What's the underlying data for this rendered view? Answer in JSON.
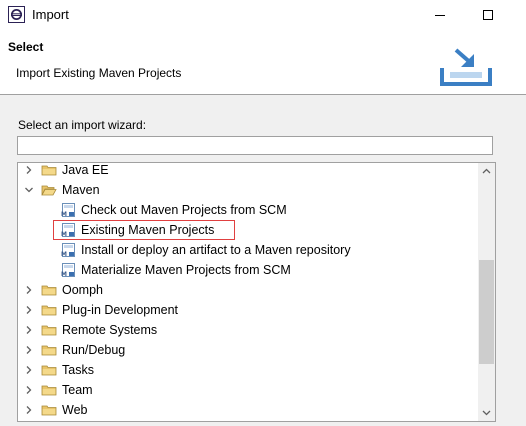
{
  "window": {
    "title": "Import"
  },
  "header": {
    "title": "Select",
    "description": "Import Existing Maven Projects"
  },
  "content": {
    "prompt": "Select an import wizard:",
    "filter_value": ""
  },
  "tree": {
    "items": [
      {
        "label": "Java EE",
        "level": 0,
        "expanded": false,
        "type": "folder"
      },
      {
        "label": "Maven",
        "level": 0,
        "expanded": true,
        "type": "folder"
      },
      {
        "label": "Check out Maven Projects from SCM",
        "level": 1,
        "type": "maven-wizard"
      },
      {
        "label": "Existing Maven Projects",
        "level": 1,
        "type": "maven-wizard",
        "selected": true
      },
      {
        "label": "Install or deploy an artifact to a Maven repository",
        "level": 1,
        "type": "maven-wizard"
      },
      {
        "label": "Materialize Maven Projects from SCM",
        "level": 1,
        "type": "maven-wizard"
      },
      {
        "label": "Oomph",
        "level": 0,
        "expanded": false,
        "type": "folder"
      },
      {
        "label": "Plug-in Development",
        "level": 0,
        "expanded": false,
        "type": "folder"
      },
      {
        "label": "Remote Systems",
        "level": 0,
        "expanded": false,
        "type": "folder"
      },
      {
        "label": "Run/Debug",
        "level": 0,
        "expanded": false,
        "type": "folder"
      },
      {
        "label": "Tasks",
        "level": 0,
        "expanded": false,
        "type": "folder"
      },
      {
        "label": "Team",
        "level": 0,
        "expanded": false,
        "type": "folder"
      },
      {
        "label": "Web",
        "level": 0,
        "expanded": false,
        "type": "folder"
      }
    ]
  },
  "colors": {
    "selection_outline": "#e04040",
    "folder": "#e8c46a",
    "header_bg": "#ffffff",
    "content_bg": "#f0f0f0"
  }
}
